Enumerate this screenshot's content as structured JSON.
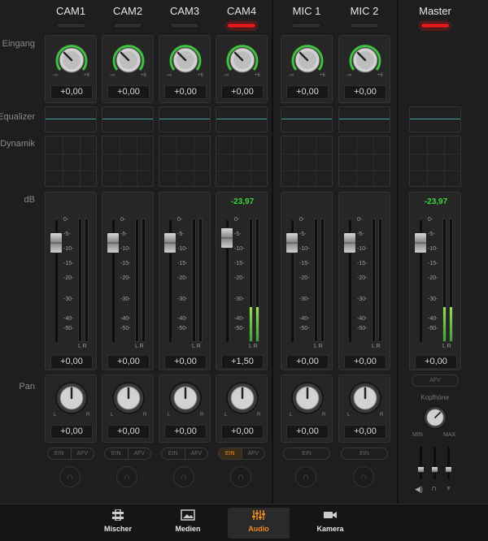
{
  "row_labels": {
    "input": "Eingang",
    "equalizer": "Equalizer",
    "dynamics": "Dynamik",
    "db": "dB",
    "pan": "Pan"
  },
  "scale": [
    "0-",
    "-5-",
    "-10-",
    "-15-",
    "-20-",
    "-30-",
    "-40-",
    "-50-"
  ],
  "channels": [
    {
      "name": "CAM1",
      "tally_on": false,
      "gain_value": "+0,00",
      "peak": "",
      "level_value": "+0,00",
      "pan_value": "+0,00",
      "ein_label": "EIN",
      "afv_label": "AFV",
      "ein_active": false,
      "has_afv": true,
      "meter_level": 0
    },
    {
      "name": "CAM2",
      "tally_on": false,
      "gain_value": "+0,00",
      "peak": "",
      "level_value": "+0,00",
      "pan_value": "+0,00",
      "ein_label": "EIN",
      "afv_label": "AFV",
      "ein_active": false,
      "has_afv": true,
      "meter_level": 0
    },
    {
      "name": "CAM3",
      "tally_on": false,
      "gain_value": "+0,00",
      "peak": "",
      "level_value": "+0,00",
      "pan_value": "+0,00",
      "ein_label": "EIN",
      "afv_label": "AFV",
      "ein_active": false,
      "has_afv": true,
      "meter_level": 0
    },
    {
      "name": "CAM4",
      "tally_on": true,
      "gain_value": "+0,00",
      "peak": "-23,97",
      "level_value": "+1,50",
      "pan_value": "+0,00",
      "ein_label": "EIN",
      "afv_label": "AFV",
      "ein_active": true,
      "has_afv": true,
      "meter_level": 0.28
    },
    {
      "name": "MIC 1",
      "tally_on": false,
      "gain_value": "+0,00",
      "peak": "",
      "level_value": "+0,00",
      "pan_value": "+0,00",
      "ein_label": "EIN",
      "afv_label": "",
      "ein_active": false,
      "has_afv": false,
      "meter_level": 0
    },
    {
      "name": "MIC 2",
      "tally_on": false,
      "gain_value": "+0,00",
      "peak": "",
      "level_value": "+0,00",
      "pan_value": "+0,00",
      "ein_label": "EIN",
      "afv_label": "",
      "ein_active": false,
      "has_afv": false,
      "meter_level": 0
    }
  ],
  "master": {
    "name": "Master",
    "tally_on": true,
    "peak": "-23,97",
    "level_value": "+0,00",
    "afv_label": "AFV",
    "headphones_label": "Kopfhörer",
    "min_label": "MIN",
    "max_label": "MAX",
    "meter_level": 0.28
  },
  "knob_scale": {
    "min": "-∞",
    "max": "+6",
    "pan_l": "L",
    "pan_r": "R"
  },
  "meter_lr": "L R",
  "nav": [
    {
      "label": "Mischer",
      "icon": "mixer-icon",
      "active": false
    },
    {
      "label": "Medien",
      "icon": "media-icon",
      "active": false
    },
    {
      "label": "Audio",
      "icon": "audio-icon",
      "active": true
    },
    {
      "label": "Kamera",
      "icon": "camera-icon",
      "active": false
    }
  ],
  "colors": {
    "accent": "#f08a1a",
    "tally": "#e01a1a",
    "meter": "#3bd63b",
    "eq_line": "#3ea6a6"
  }
}
